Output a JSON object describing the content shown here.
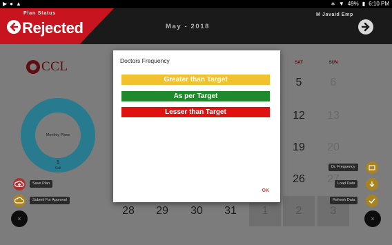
{
  "status_bar": {
    "battery": "49%",
    "time": "6:10 PM"
  },
  "header": {
    "plan_status_label": "Plan Status",
    "status": "Rejected",
    "month": "May - 2018",
    "user": "M Javaid  Emp"
  },
  "logo": {
    "text": "CCL"
  },
  "donut": {
    "label": "Monthly Plans",
    "count": "1",
    "sub": "Call"
  },
  "actions": {
    "save_plan": "Save Plan",
    "submit_for_approval": "Submit For Approval",
    "dr_frequency": "Dr. Frequency",
    "load_data": "Load Data",
    "refresh_data": "Refresh Data",
    "close_glyph": "×"
  },
  "calendar": {
    "headers": {
      "sat": "SAT",
      "sun": "SUN"
    },
    "right_cols": [
      {
        "sat": "5",
        "sun": "6"
      },
      {
        "sat": "12",
        "sun": "13"
      },
      {
        "sat": "19",
        "sun": "20"
      },
      {
        "sat": "26",
        "sun": "27"
      }
    ],
    "bottom_row": [
      "28",
      "29",
      "30",
      "31",
      "1",
      "2",
      "3"
    ]
  },
  "dialog": {
    "title": "Doctors Frequency",
    "items": [
      {
        "label": "Greater than Target",
        "color": "#f2c12e"
      },
      {
        "label": "As per Target",
        "color": "#1e8a2b"
      },
      {
        "label": "Lesser than Target",
        "color": "#e01111"
      }
    ],
    "ok": "OK"
  },
  "colors": {
    "accent_red": "#c8141e",
    "header_bg": "#1a1a1a",
    "donut": "#287a8e"
  },
  "icons": [
    "back-arrow-icon",
    "forward-arrow-icon",
    "cloud-upload-icon",
    "submit-icon",
    "chart-icon",
    "download-icon",
    "check-icon",
    "close-icon"
  ]
}
